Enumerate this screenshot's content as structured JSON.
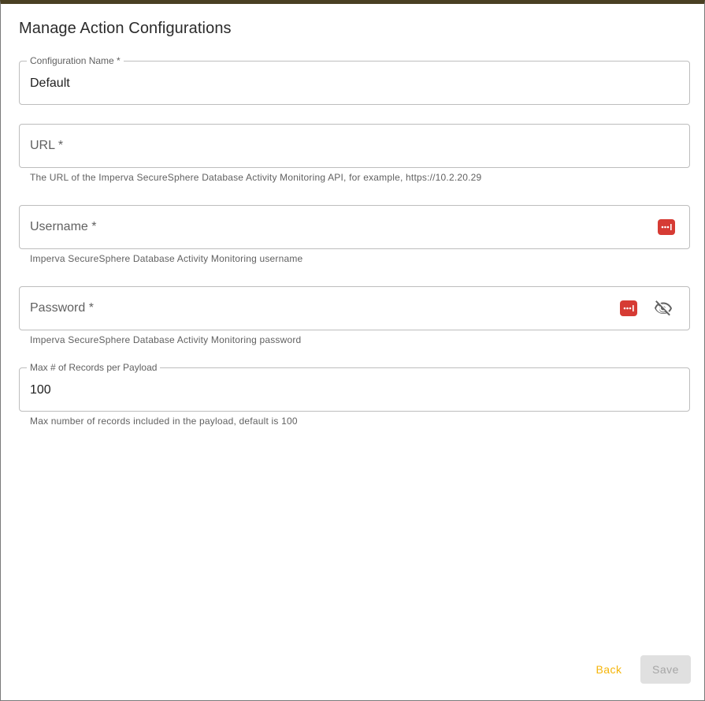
{
  "dialog": {
    "title": "Manage Action Configurations"
  },
  "fields": {
    "config_name": {
      "label": "Configuration Name *",
      "value": "Default"
    },
    "url": {
      "label": "URL *",
      "value": "",
      "hint": "The URL of the Imperva SecureSphere Database Activity Monitoring API, for example, https://10.2.20.29"
    },
    "username": {
      "label": "Username *",
      "value": "",
      "hint": "Imperva SecureSphere Database Activity Monitoring username",
      "icon": "password-manager-icon"
    },
    "password": {
      "label": "Password *",
      "value": "",
      "hint": "Imperva SecureSphere Database Activity Monitoring password",
      "icons": [
        "password-manager-icon",
        "visibility-off-icon"
      ]
    },
    "max_records": {
      "label": "Max # of Records per Payload",
      "value": "100",
      "hint": "Max number of records included in the payload, default is 100"
    }
  },
  "actions": {
    "back_label": "Back",
    "save_label": "Save"
  },
  "colors": {
    "top_bar": "#4a4023",
    "accent": "#f5b50a",
    "password_manager": "#d63b34",
    "disabled_bg": "#e0e0e0"
  }
}
